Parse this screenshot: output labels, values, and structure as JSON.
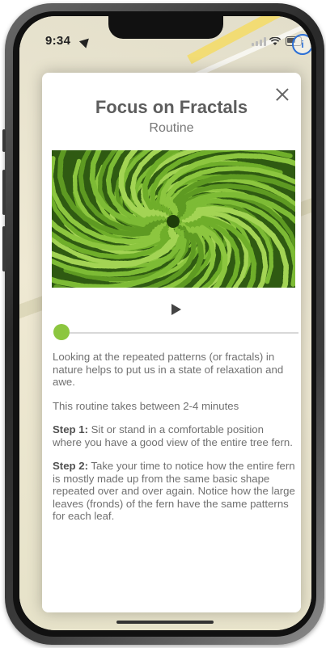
{
  "status_bar": {
    "time": "9:34",
    "info_badge": "i"
  },
  "modal": {
    "title": "Focus on Fractals",
    "subtitle": "Routine",
    "image_icon": "fern-photo",
    "close_icon": "close-icon",
    "play_icon": "play-icon",
    "playback_progress": 0.0,
    "paragraphs": [
      {
        "bold": "",
        "text": "Looking at the repeated patterns (or fractals) in nature helps to put us in a state of relaxation and awe."
      },
      {
        "bold": "",
        "text": "This routine takes between 2-4 minutes"
      },
      {
        "bold": "Step 1:",
        "text": " Sit or stand in a comfortable position where you have a good view of the entire tree fern."
      },
      {
        "bold": "Step 2:",
        "text": " Take your time to notice how the entire fern is mostly made up from the same basic shape repeated over and over again. Notice how the large leaves (fronds) of the fern have the same patterns for each leaf."
      }
    ]
  },
  "colors": {
    "accent": "#8cc63f",
    "title": "#5d5d5d",
    "body": "#707070",
    "info_badge": "#2b6fd6"
  }
}
